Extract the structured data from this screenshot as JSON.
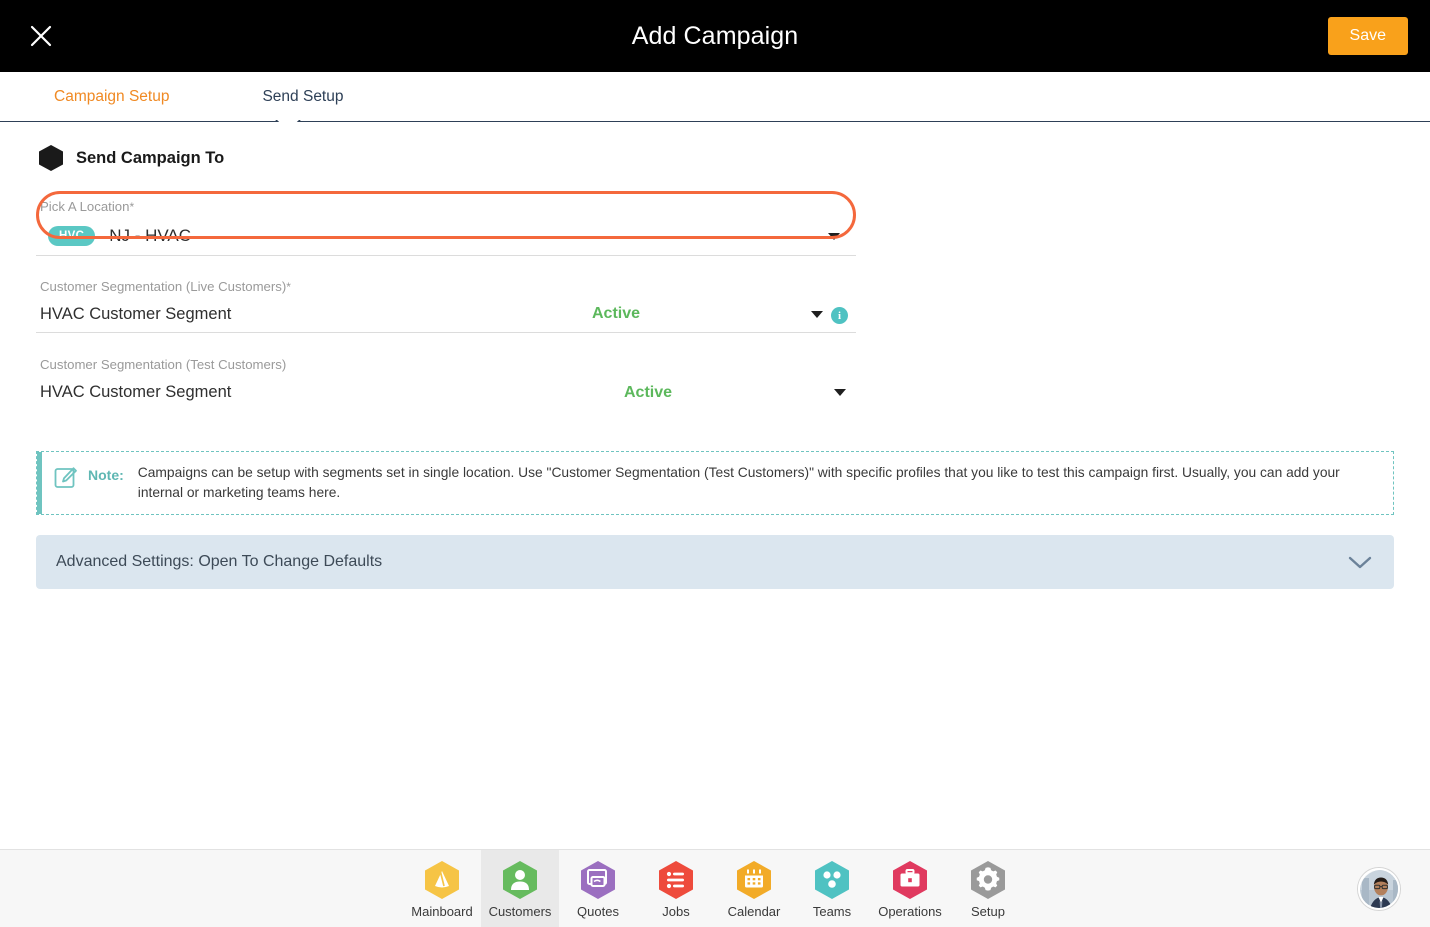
{
  "window": {
    "title": "Add Campaign",
    "close_icon": "close-icon",
    "save_label": "Save"
  },
  "tabs": [
    {
      "label": "Campaign Setup",
      "active": true
    },
    {
      "label": "Send Setup",
      "active": false
    }
  ],
  "section": {
    "icon": "hexagon-icon",
    "title": "Send Campaign To"
  },
  "fields": {
    "location": {
      "label": "Pick A Location",
      "required_mark": "*",
      "badge": "HVC",
      "value": "NJ - HVAC",
      "caret_icon": "caret-down-icon",
      "highlighted": true
    },
    "live_segment": {
      "label": "Customer Segmentation (Live Customers)",
      "required_mark": "*",
      "value": "HVAC Customer Segment",
      "status": "Active",
      "caret_icon": "caret-down-icon",
      "info_icon": "info-icon",
      "info_glyph": "i"
    },
    "test_segment": {
      "label": "Customer Segmentation (Test Customers)",
      "required_mark": "",
      "value": "HVAC Customer Segment",
      "status": "Active",
      "caret_icon": "caret-down-icon"
    }
  },
  "note": {
    "icon": "edit-note-icon",
    "label": "Note:",
    "text": "Campaigns can be setup with segments set in single location. Use \"Customer Segmentation (Test Customers)\" with specific profiles that you like to test this campaign first. Usually, you can add your internal or marketing teams here."
  },
  "advanced": {
    "label": "Advanced Settings: Open To Change Defaults",
    "chevron_icon": "chevron-down-icon"
  },
  "bottom_nav": {
    "items": [
      {
        "label": "Mainboard",
        "icon": "mainboard-icon",
        "color": "#f6c445",
        "selected": false
      },
      {
        "label": "Customers",
        "icon": "customers-icon",
        "color": "#66bb5e",
        "selected": true
      },
      {
        "label": "Quotes",
        "icon": "quotes-icon",
        "color": "#9b6fc0",
        "selected": false
      },
      {
        "label": "Jobs",
        "icon": "jobs-icon",
        "color": "#ee4b3c",
        "selected": false
      },
      {
        "label": "Calendar",
        "icon": "calendar-icon",
        "color": "#f2ab28",
        "selected": false
      },
      {
        "label": "Teams",
        "icon": "teams-icon",
        "color": "#4fc2c2",
        "selected": false
      },
      {
        "label": "Operations",
        "icon": "operations-icon",
        "color": "#e03a5f",
        "selected": false
      },
      {
        "label": "Setup",
        "icon": "setup-icon",
        "color": "#9a9a9a",
        "selected": false
      }
    ],
    "avatar": "user-avatar"
  },
  "colors": {
    "accent_orange": "#f9a11b",
    "highlight_ring": "#f4683c",
    "teal": "#5bc8c4",
    "status_green": "#5cb85c",
    "titlebar": "#000000",
    "advanced_bg": "#dbe6ef"
  }
}
